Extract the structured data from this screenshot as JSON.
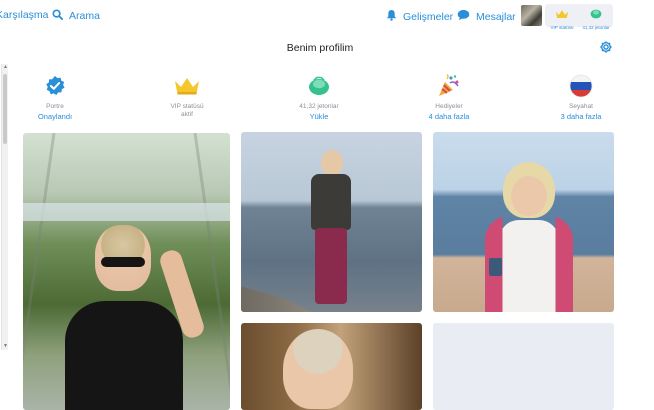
{
  "nav": {
    "meetings_label": "Karşılaşma",
    "search_label": "Arama",
    "news_label": "Gelişmeler",
    "messages_label": "Mesajlar"
  },
  "status_box": {
    "vip_label": "VIP statüsü",
    "coins_label": "41,32 jetonlar"
  },
  "page": {
    "title": "Benim profilim"
  },
  "stats": [
    {
      "icon": "verified-check-icon",
      "sub": "Portre",
      "action": "Onaylandı"
    },
    {
      "icon": "crown-icon",
      "sub": "VIP statüsü\naktif",
      "action": ""
    },
    {
      "icon": "coins-icon",
      "sub": "41,32 jetonlar",
      "action": "Yükle"
    },
    {
      "icon": "party-popper-icon",
      "sub": "Hediyeler",
      "action": "4 daha fazla"
    },
    {
      "icon": "russia-flag-icon",
      "sub": "Seyahat",
      "action": "3 daha fazla"
    }
  ],
  "colors": {
    "accent": "#2a8fd8",
    "muted": "#8a8f98",
    "crown": "#f5c72c",
    "coins": "#35c28f"
  }
}
